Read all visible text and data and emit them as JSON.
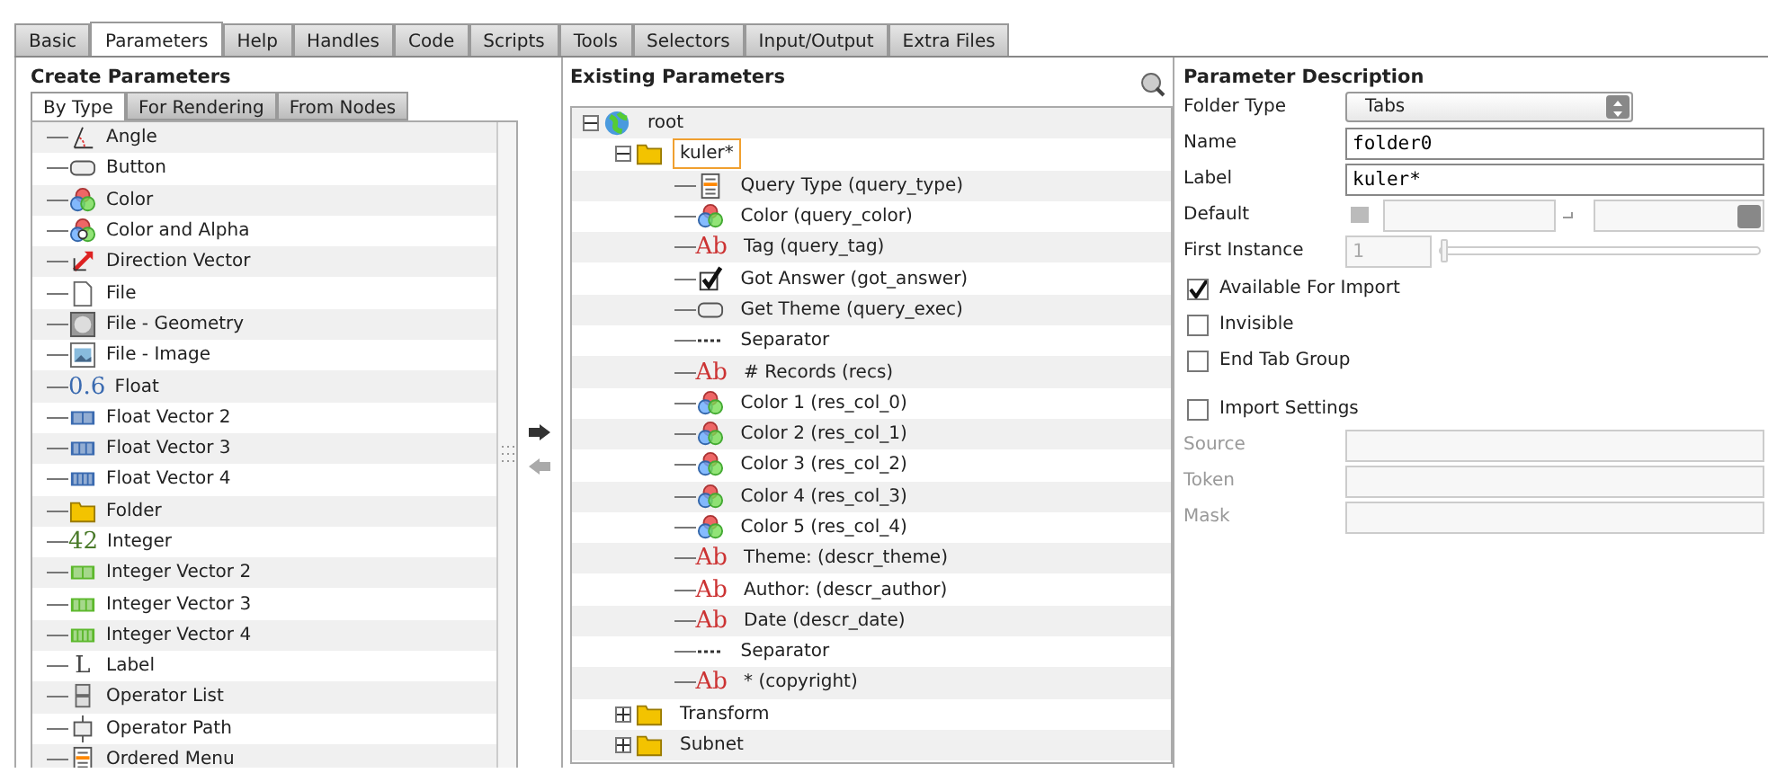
{
  "tabs": [
    {
      "label": "Basic",
      "selected": false
    },
    {
      "label": "Parameters",
      "selected": true
    },
    {
      "label": "Help",
      "selected": false
    },
    {
      "label": "Handles",
      "selected": false
    },
    {
      "label": "Code",
      "selected": false
    },
    {
      "label": "Scripts",
      "selected": false
    },
    {
      "label": "Tools",
      "selected": false
    },
    {
      "label": "Selectors",
      "selected": false
    },
    {
      "label": "Input/Output",
      "selected": false
    },
    {
      "label": "Extra Files",
      "selected": false
    }
  ],
  "create_parameters": {
    "title": "Create Parameters",
    "tabs": [
      {
        "label": "By Type",
        "selected": true
      },
      {
        "label": "For Rendering",
        "selected": false
      },
      {
        "label": "From Nodes",
        "selected": false
      }
    ],
    "items": [
      {
        "label": "Angle",
        "kind": "angle"
      },
      {
        "label": "Button",
        "kind": "button"
      },
      {
        "label": "Color",
        "kind": "color"
      },
      {
        "label": "Color and Alpha",
        "kind": "rgba"
      },
      {
        "label": "Direction Vector",
        "kind": "direction"
      },
      {
        "label": "File",
        "kind": "file"
      },
      {
        "label": "File - Geometry",
        "kind": "geometry"
      },
      {
        "label": "File - Image",
        "kind": "image"
      },
      {
        "label": "Float",
        "kind": "float",
        "glyph": "0.6"
      },
      {
        "label": "Float Vector 2",
        "kind": "fvector2"
      },
      {
        "label": "Float Vector 3",
        "kind": "fvector3"
      },
      {
        "label": "Float Vector 4",
        "kind": "fvector4"
      },
      {
        "label": "Folder",
        "kind": "folder"
      },
      {
        "label": "Integer",
        "kind": "integer",
        "glyph": "42"
      },
      {
        "label": "Integer Vector 2",
        "kind": "ivector2"
      },
      {
        "label": "Integer Vector 3",
        "kind": "ivector3"
      },
      {
        "label": "Integer Vector 4",
        "kind": "ivector4"
      },
      {
        "label": "Label",
        "kind": "label",
        "glyph": "L"
      },
      {
        "label": "Operator List",
        "kind": "oplist"
      },
      {
        "label": "Operator Path",
        "kind": "oppath"
      },
      {
        "label": "Ordered Menu",
        "kind": "menu"
      }
    ]
  },
  "existing_parameters": {
    "title": "Existing Parameters",
    "tree": [
      {
        "label": "root",
        "kind": "globe",
        "expanded": true,
        "selected": false,
        "children": [
          {
            "label": "kuler*",
            "kind": "folder",
            "expanded": true,
            "selected": true,
            "children": [
              {
                "label": "Query Type (query_type)",
                "kind": "menu"
              },
              {
                "label": "Color (query_color)",
                "kind": "color"
              },
              {
                "label": "Tag (query_tag)",
                "kind": "glyph",
                "glyph": "Ab"
              },
              {
                "label": "Got Answer (got_answer)",
                "kind": "toggle"
              },
              {
                "label": "Get Theme (query_exec)",
                "kind": "button"
              },
              {
                "label": "Separator",
                "kind": "separator"
              },
              {
                "label": "# Records (recs)",
                "kind": "glyph",
                "glyph": "Ab"
              },
              {
                "label": "Color 1 (res_col_0)",
                "kind": "color"
              },
              {
                "label": "Color 2 (res_col_1)",
                "kind": "color"
              },
              {
                "label": "Color 3 (res_col_2)",
                "kind": "color"
              },
              {
                "label": "Color 4 (res_col_3)",
                "kind": "color"
              },
              {
                "label": "Color 5 (res_col_4)",
                "kind": "color"
              },
              {
                "label": "Theme: (descr_theme)",
                "kind": "glyph",
                "glyph": "Ab"
              },
              {
                "label": "Author: (descr_author)",
                "kind": "glyph",
                "glyph": "Ab"
              },
              {
                "label": "Date (descr_date)",
                "kind": "glyph",
                "glyph": "Ab"
              },
              {
                "label": "Separator",
                "kind": "separator"
              },
              {
                "label": "* (copyright)",
                "kind": "glyph",
                "glyph": "Ab"
              }
            ]
          },
          {
            "label": "Transform",
            "kind": "folder",
            "expanded": false,
            "selected": false
          },
          {
            "label": "Subnet",
            "kind": "folder",
            "expanded": false,
            "selected": false
          }
        ]
      }
    ]
  },
  "parameter_description": {
    "title": "Parameter Description",
    "fields": [
      {
        "label": "Folder Type",
        "kind": "select",
        "value": "Tabs"
      },
      {
        "label": "Name",
        "kind": "text",
        "value": "folder0"
      },
      {
        "label": "Label",
        "kind": "text",
        "value": "kuler*"
      },
      {
        "label": "Default",
        "kind": "pair",
        "disabled": true
      },
      {
        "label": "First Instance",
        "kind": "slider",
        "value": "1",
        "disabled": true,
        "level": 0
      },
      {
        "label": "Available For Import",
        "kind": "check",
        "checked": true
      },
      {
        "label": "Invisible",
        "kind": "check",
        "checked": false
      },
      {
        "label": "End Tab Group",
        "kind": "check",
        "checked": false
      },
      {
        "label": "Import Settings",
        "kind": "check",
        "checked": false
      },
      {
        "label": "Source",
        "kind": "text",
        "disabled": true
      },
      {
        "label": "Token",
        "kind": "text",
        "disabled": true
      },
      {
        "label": "Mask",
        "kind": "text",
        "disabled": true
      }
    ]
  }
}
